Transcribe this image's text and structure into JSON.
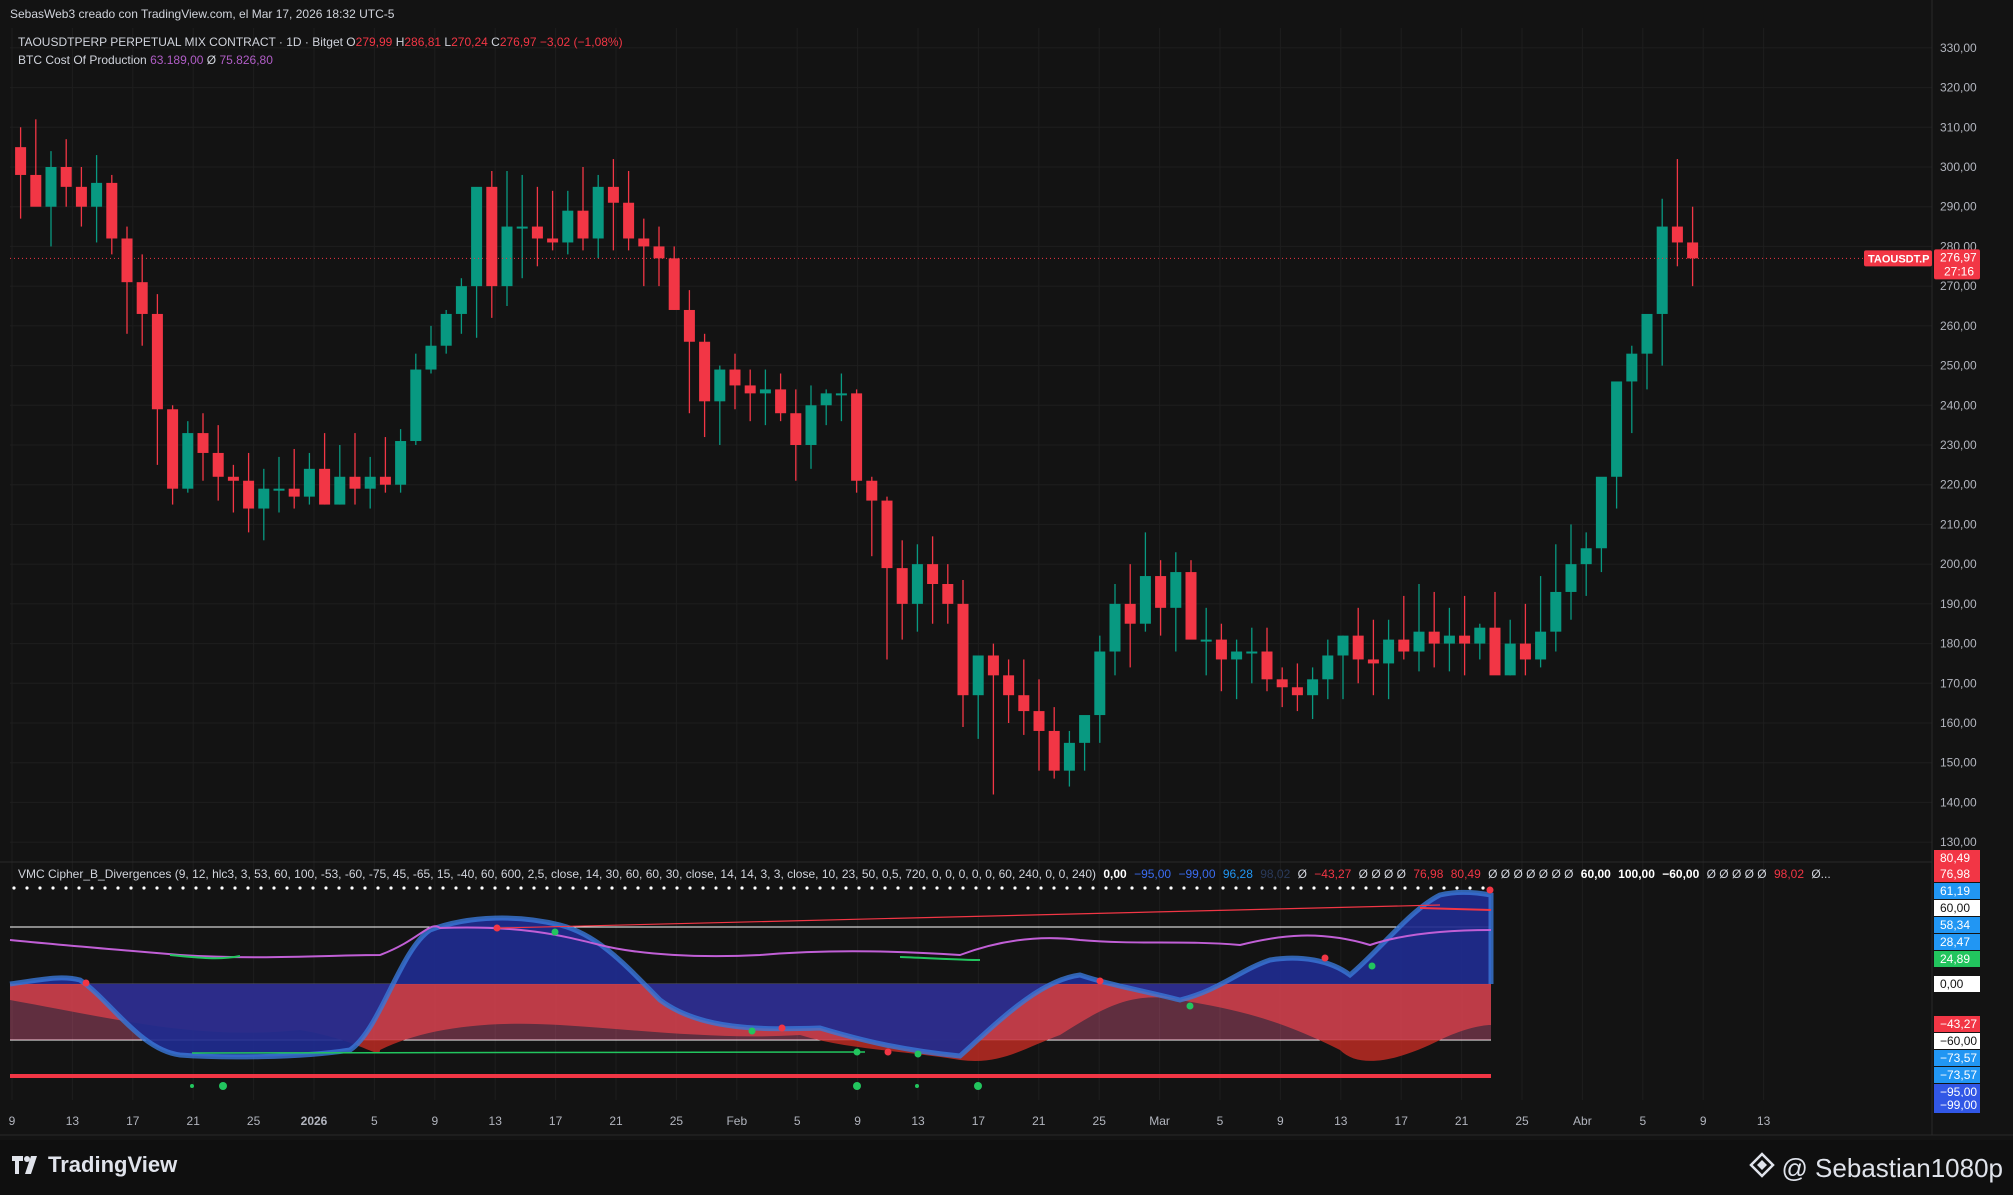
{
  "top_caption": "SebasWeb3 creado con TradingView.com, el Mar 17, 2026 18:32 UTC-5",
  "symbol_line": {
    "title": "TAOUSDTPERP PERPETUAL MIX CONTRACT · 1D · Bitget",
    "o_label": "O",
    "o": "279,99",
    "h_label": "H",
    "h": "286,81",
    "l_label": "L",
    "l": "270,24",
    "c_label": "C",
    "c": "276,97",
    "change": "−3,02 (−1,08%)"
  },
  "indicator_line": {
    "name": "BTC Cost Of Production",
    "v1": "63.189,00",
    "sep": "Ø",
    "v2": "75.826,80"
  },
  "vmc_line": {
    "name": "VMC Cipher_B_Divergences (9, 12, hlc3, 3, 53, 60, 100, -53, -60, -75, 45, -65, 15, -40, 60, 600, 2,5, close, 14, 30, 60, 60, 30, close, 14, 14, 3, 3, close, 10, 23, 50, 0,5, 720, 0, 0, 0, 0, 0, 60, 240, 0, 0, 240)",
    "values": [
      "0,00",
      "−95,00",
      "−99,00",
      "96,28",
      "98,02",
      "Ø",
      "−43,27",
      "Ø Ø Ø Ø",
      "76,98",
      "80,49",
      "Ø Ø Ø Ø Ø Ø Ø",
      "60,00",
      "100,00",
      "−60,00",
      "Ø Ø Ø Ø Ø",
      "98,02",
      "Ø..."
    ]
  },
  "price_axis": {
    "ticks": [
      "330,00",
      "320,00",
      "310,00",
      "300,00",
      "290,00",
      "280,00",
      "270,00",
      "260,00",
      "250,00",
      "240,00",
      "230,00",
      "220,00",
      "210,00",
      "200,00",
      "190,00",
      "180,00",
      "170,00",
      "160,00",
      "150,00",
      "140,00",
      "130,00"
    ],
    "last_tag": "TAOUSDT.P",
    "last_price": "276,97",
    "countdown": "27:16"
  },
  "osc_axis": {
    "labels": [
      {
        "text": "80,49",
        "bg": "#f23645"
      },
      {
        "text": "76,98",
        "bg": "#f23645"
      },
      {
        "text": "61,19",
        "bg": "#2196f3"
      },
      {
        "text": "60,00",
        "bg": "#ffffff"
      },
      {
        "text": "58,34",
        "bg": "#2196f3"
      },
      {
        "text": "28,47",
        "bg": "#2196f3"
      },
      {
        "text": "24,89",
        "bg": "#22c55e"
      },
      {
        "text": "0,00",
        "bg": "#ffffff"
      },
      {
        "text": "−43,27",
        "bg": "#f23645"
      },
      {
        "text": "−60,00",
        "bg": "#ffffff"
      },
      {
        "text": "−73,57",
        "bg": "#2196f3"
      },
      {
        "text": "−73,57",
        "bg": "#2196f3"
      },
      {
        "text": "−95,00",
        "bg": "#3157e6"
      },
      {
        "text": "−99,00",
        "bg": "#3157e6"
      }
    ]
  },
  "time_axis": [
    "9",
    "13",
    "17",
    "21",
    "25",
    "2026",
    "5",
    "9",
    "13",
    "17",
    "21",
    "25",
    "Feb",
    "5",
    "9",
    "13",
    "17",
    "21",
    "25",
    "Mar",
    "5",
    "9",
    "13",
    "17",
    "21",
    "25",
    "Abr",
    "5",
    "9",
    "13"
  ],
  "footer": {
    "brand": "TradingView",
    "user": "@ Sebastian1080p"
  },
  "colors": {
    "up": "#089981",
    "down": "#f23645",
    "bg": "#131313",
    "grid": "#1e1e1e"
  },
  "chart_data": {
    "type": "candlestick",
    "title": "TAOUSDTPERP PERPETUAL MIX CONTRACT · 1D · Bitget",
    "ylim": [
      125,
      335
    ],
    "x_start": "Dec 9, 2025",
    "candles": [
      [
        305,
        310,
        287,
        298
      ],
      [
        298,
        312,
        294,
        290
      ],
      [
        290,
        304,
        280,
        300
      ],
      [
        300,
        307,
        290,
        295
      ],
      [
        295,
        300,
        285,
        290
      ],
      [
        290,
        303,
        281,
        296
      ],
      [
        296,
        298,
        278,
        282
      ],
      [
        282,
        285,
        258,
        271
      ],
      [
        271,
        278,
        255,
        263
      ],
      [
        263,
        268,
        225,
        239
      ],
      [
        239,
        240,
        215,
        219
      ],
      [
        219,
        236,
        218,
        233
      ],
      [
        233,
        238,
        221,
        228
      ],
      [
        228,
        235,
        216,
        222
      ],
      [
        222,
        225,
        213,
        221
      ],
      [
        221,
        228,
        208,
        214
      ],
      [
        214,
        224,
        206,
        219
      ],
      [
        219,
        227,
        213,
        219
      ],
      [
        219,
        229,
        214,
        217
      ],
      [
        217,
        228,
        215,
        224
      ],
      [
        224,
        233,
        215,
        215
      ],
      [
        215,
        230,
        215,
        222
      ],
      [
        222,
        233,
        215,
        219
      ],
      [
        219,
        227,
        214,
        222
      ],
      [
        222,
        232,
        218,
        220
      ],
      [
        220,
        234,
        218,
        231
      ],
      [
        231,
        253,
        230,
        249
      ],
      [
        249,
        260,
        248,
        255
      ],
      [
        255,
        264,
        253,
        263
      ],
      [
        263,
        272,
        258,
        270
      ],
      [
        270,
        285,
        257,
        295
      ],
      [
        295,
        299,
        262,
        270
      ],
      [
        270,
        299,
        265,
        285
      ],
      [
        285,
        298,
        272,
        285
      ],
      [
        285,
        295,
        275,
        282
      ],
      [
        282,
        294,
        279,
        281
      ],
      [
        281,
        294,
        278,
        289
      ],
      [
        289,
        300,
        279,
        282
      ],
      [
        282,
        298,
        277,
        295
      ],
      [
        295,
        302,
        279,
        291
      ],
      [
        291,
        299,
        279,
        282
      ],
      [
        282,
        287,
        270,
        280
      ],
      [
        280,
        285,
        270,
        277
      ],
      [
        277,
        280,
        264,
        264
      ],
      [
        264,
        269,
        238,
        256
      ],
      [
        256,
        258,
        232,
        241
      ],
      [
        241,
        250,
        230,
        249
      ],
      [
        249,
        253,
        239,
        245
      ],
      [
        245,
        249,
        236,
        243
      ],
      [
        243,
        249,
        235,
        244
      ],
      [
        244,
        248,
        236,
        238
      ],
      [
        238,
        244,
        221,
        230
      ],
      [
        230,
        245,
        224,
        240
      ],
      [
        240,
        244,
        235,
        243
      ],
      [
        243,
        248,
        236,
        243
      ],
      [
        243,
        244,
        218,
        221
      ],
      [
        221,
        222,
        202,
        216
      ],
      [
        216,
        217,
        176,
        199
      ],
      [
        199,
        206,
        181,
        190
      ],
      [
        190,
        205,
        183,
        200
      ],
      [
        200,
        207,
        185,
        195
      ],
      [
        195,
        200,
        185,
        190
      ],
      [
        190,
        196,
        159,
        167
      ],
      [
        167,
        172,
        156,
        177
      ],
      [
        177,
        180,
        142,
        172
      ],
      [
        172,
        176,
        160,
        167
      ],
      [
        167,
        176,
        157,
        163
      ],
      [
        163,
        171,
        148,
        158
      ],
      [
        158,
        164,
        146,
        148
      ],
      [
        148,
        158,
        144,
        155
      ],
      [
        155,
        161,
        148,
        162
      ],
      [
        162,
        182,
        155,
        178
      ],
      [
        178,
        195,
        172,
        190
      ],
      [
        190,
        200,
        174,
        185
      ],
      [
        185,
        208,
        183,
        197
      ],
      [
        197,
        201,
        182,
        189
      ],
      [
        189,
        203,
        178,
        198
      ],
      [
        198,
        201,
        185,
        181
      ],
      [
        181,
        189,
        172,
        181
      ],
      [
        181,
        185,
        168,
        176
      ],
      [
        176,
        181,
        166,
        178
      ],
      [
        178,
        184,
        170,
        178
      ],
      [
        178,
        184,
        168,
        171
      ],
      [
        171,
        174,
        164,
        169
      ],
      [
        169,
        175,
        163,
        167
      ],
      [
        167,
        174,
        161,
        171
      ],
      [
        171,
        181,
        166,
        177
      ],
      [
        177,
        182,
        166,
        182
      ],
      [
        182,
        189,
        170,
        176
      ],
      [
        176,
        186,
        167,
        175
      ],
      [
        175,
        186,
        166,
        181
      ],
      [
        181,
        192,
        176,
        178
      ],
      [
        178,
        195,
        173,
        183
      ],
      [
        183,
        193,
        174,
        180
      ],
      [
        180,
        189,
        173,
        182
      ],
      [
        182,
        192,
        172,
        180
      ],
      [
        180,
        185,
        176,
        184
      ],
      [
        184,
        193,
        176,
        172
      ],
      [
        172,
        186,
        172,
        180
      ],
      [
        180,
        190,
        172,
        176
      ],
      [
        176,
        197,
        174,
        183
      ],
      [
        183,
        205,
        178,
        193
      ],
      [
        193,
        210,
        186,
        200
      ],
      [
        200,
        208,
        192,
        204
      ],
      [
        204,
        212,
        198,
        222
      ],
      [
        222,
        237,
        214,
        246
      ],
      [
        246,
        255,
        233,
        253
      ],
      [
        253,
        262,
        244,
        263
      ],
      [
        263,
        292,
        250,
        285
      ],
      [
        285,
        302,
        275,
        281
      ],
      [
        281,
        290,
        270,
        277
      ]
    ]
  }
}
